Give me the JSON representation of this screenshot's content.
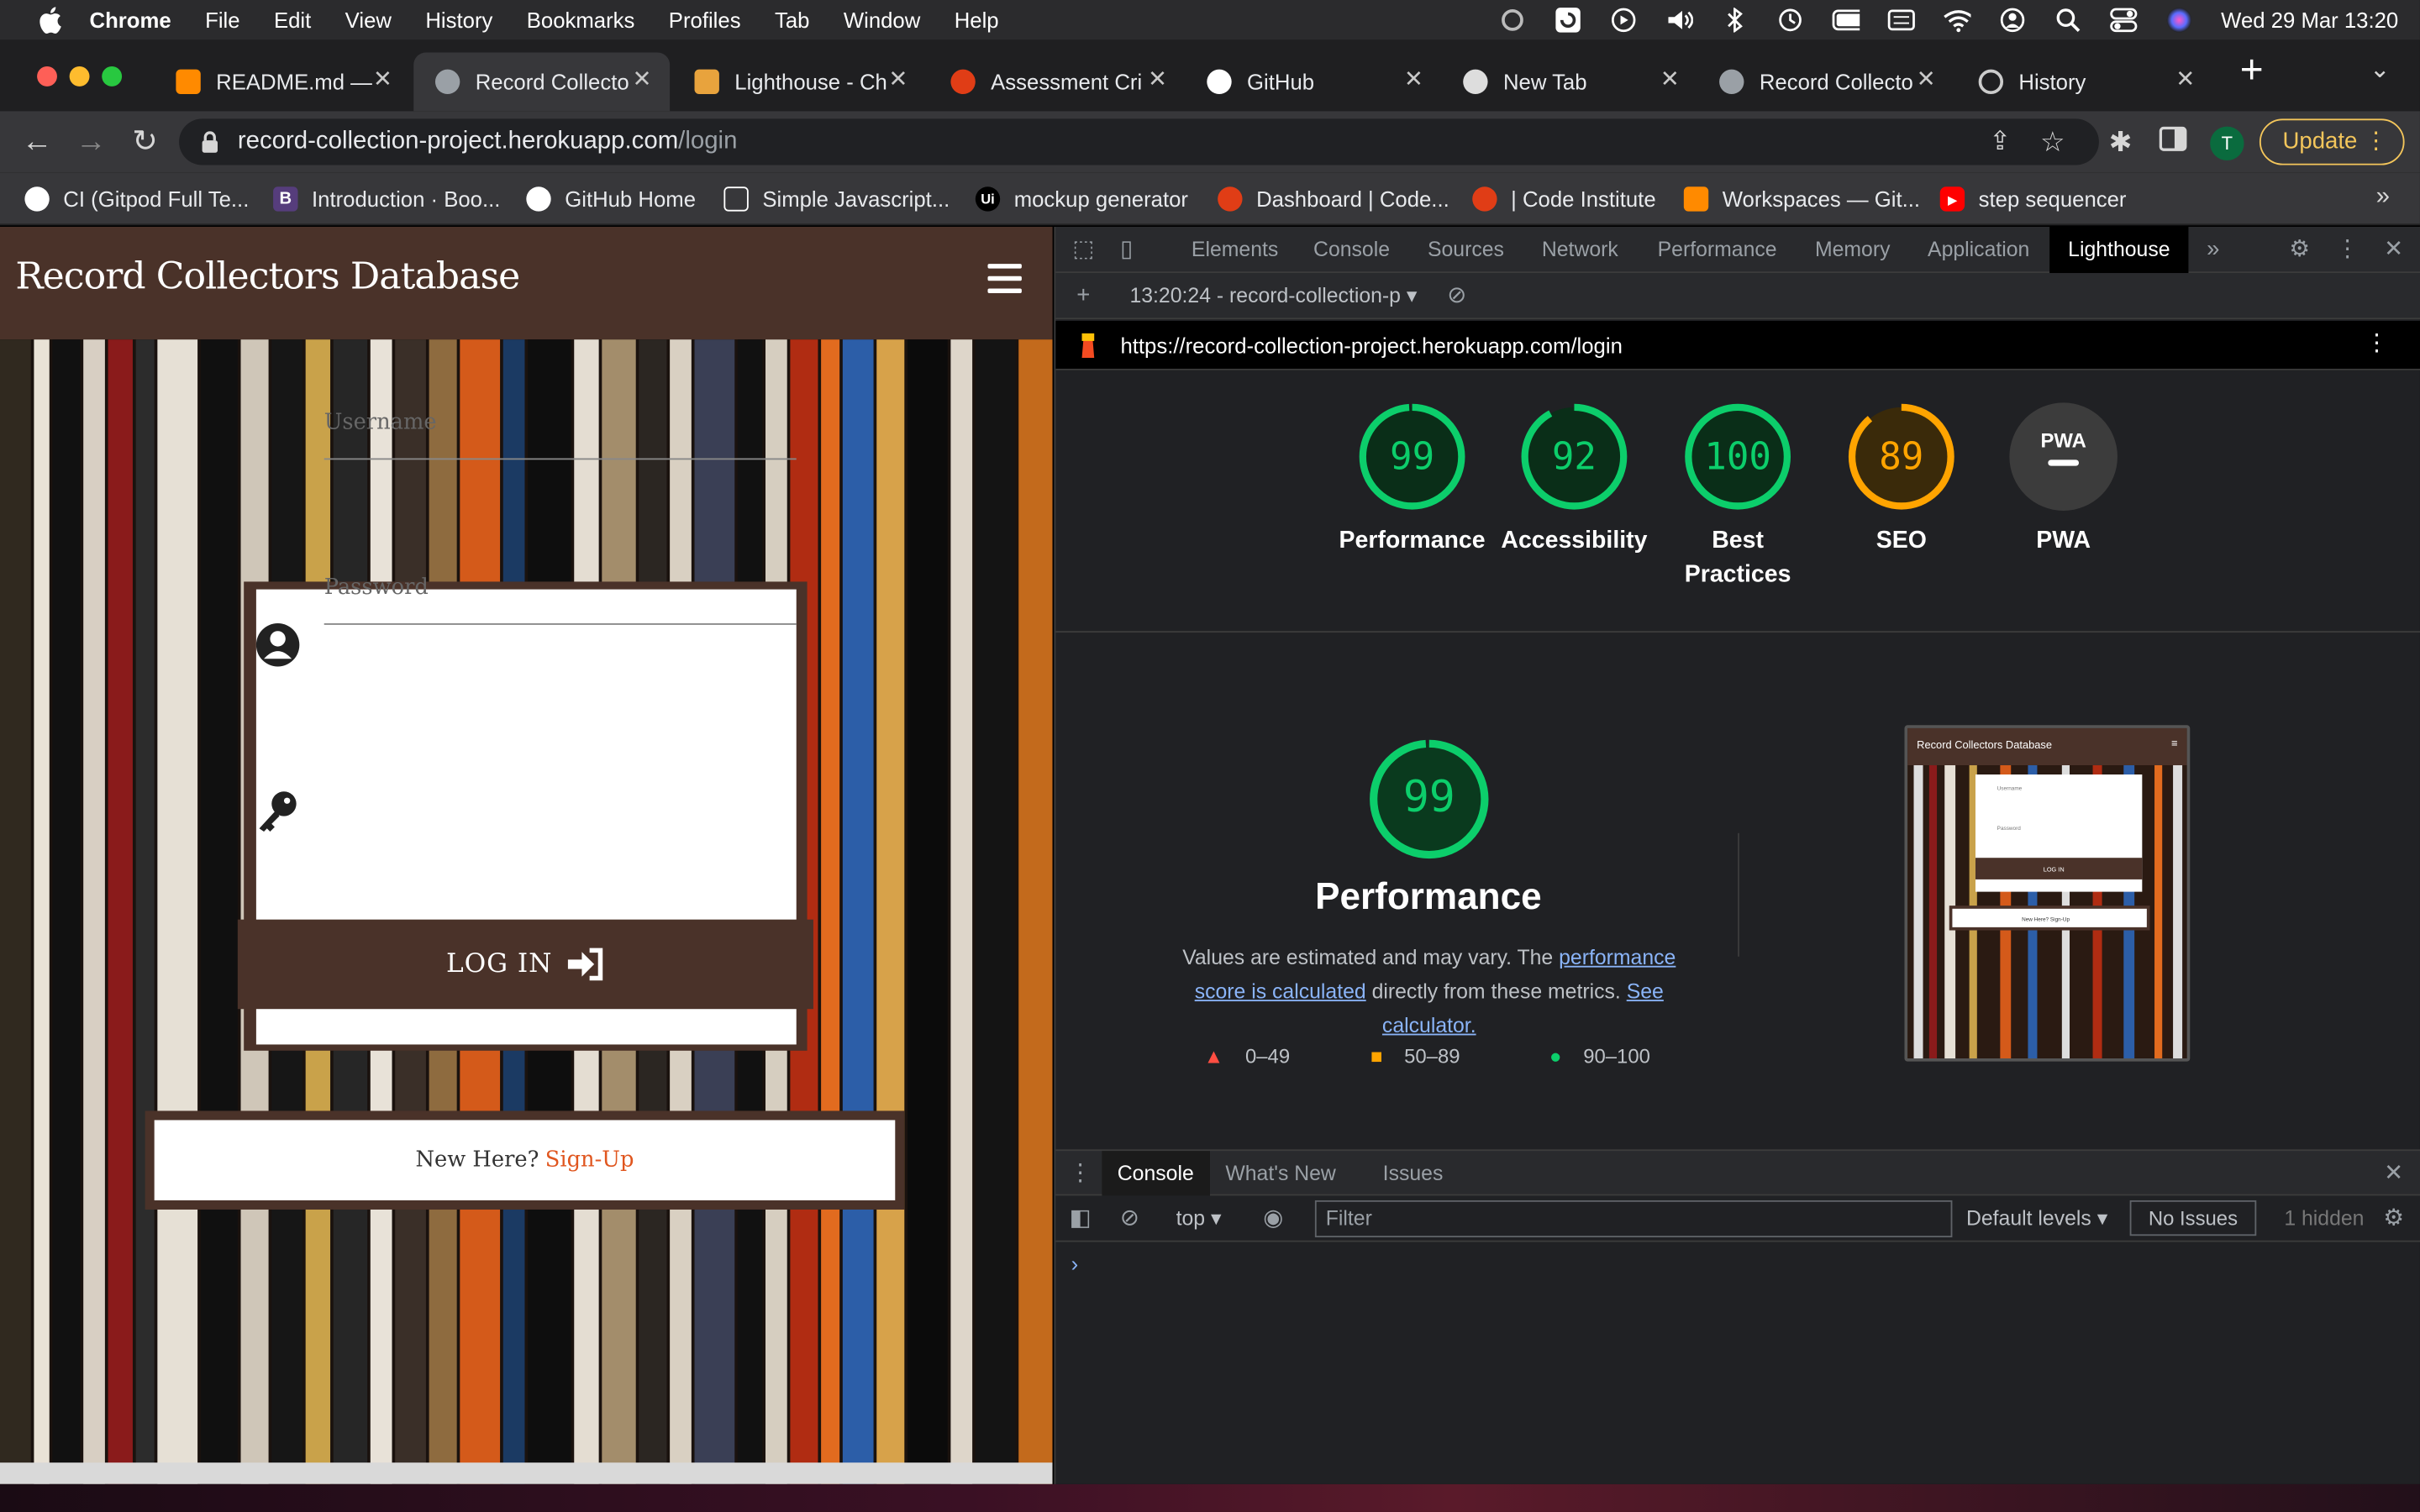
{
  "menubar": {
    "app": "Chrome",
    "items": [
      "File",
      "Edit",
      "View",
      "History",
      "Bookmarks",
      "Profiles",
      "Tab",
      "Window",
      "Help"
    ],
    "clock": "Wed 29 Mar  13:20"
  },
  "tabs": [
    {
      "title": "README.md — ",
      "icon": "gitpod-icon"
    },
    {
      "title": "Record Collecto",
      "icon": "globe-icon",
      "active": true
    },
    {
      "title": "Lighthouse - Ch",
      "icon": "lighthouse-icon"
    },
    {
      "title": "Assessment Cri",
      "icon": "code-institute-icon"
    },
    {
      "title": "GitHub",
      "icon": "github-icon"
    },
    {
      "title": "New Tab",
      "icon": "chrome-icon"
    },
    {
      "title": "Record Collecto",
      "icon": "globe-icon"
    },
    {
      "title": "History",
      "icon": "history-icon"
    }
  ],
  "omnibox": {
    "host": "record-collection-project.herokuapp.com",
    "path": "/login"
  },
  "toolbar": {
    "update_label": "Update",
    "avatar_letter": "T"
  },
  "bookmarks": [
    {
      "label": "CI (Gitpod Full Te...",
      "icon": "github-icon"
    },
    {
      "label": "Introduction · Boo...",
      "icon": "bootstrap-icon"
    },
    {
      "label": "GitHub Home",
      "icon": "github-icon"
    },
    {
      "label": "Simple Javascript...",
      "icon": "codepen-icon"
    },
    {
      "label": "mockup generator",
      "icon": "ui-icon"
    },
    {
      "label": "Dashboard | Code...",
      "icon": "code-institute-icon"
    },
    {
      "label": "| Code Institute",
      "icon": "code-institute-icon"
    },
    {
      "label": "Workspaces — Git...",
      "icon": "gitpod-icon"
    },
    {
      "label": "step sequencer",
      "icon": "youtube-icon"
    }
  ],
  "site": {
    "title": "Record Collectors Database",
    "username_placeholder": "Username",
    "password_placeholder": "Password",
    "login_label": "LOG IN",
    "signup_prompt": "New Here?",
    "signup_link": "Sign-Up",
    "thumb_title": "Record Collectors Database",
    "thumb_username": "Username",
    "thumb_password": "Password",
    "thumb_login": "LOG IN",
    "thumb_signup": "New Here? Sign-Up"
  },
  "devtools": {
    "tabs": [
      "Elements",
      "Console",
      "Sources",
      "Network",
      "Performance",
      "Memory",
      "Application",
      "Lighthouse"
    ],
    "active_tab": "Lighthouse",
    "run_label": "13:20:24 - record-collection-p",
    "report_url": "https://record-collection-project.herokuapp.com/login",
    "scores": [
      {
        "label": "Performance",
        "value": 99,
        "color": "#0cce6b"
      },
      {
        "label": "Accessibility",
        "value": 92,
        "color": "#0cce6b"
      },
      {
        "label": "Best Practices",
        "value": 100,
        "color": "#0cce6b"
      },
      {
        "label": "SEO",
        "value": 89,
        "color": "#ffa400"
      },
      {
        "label": "PWA",
        "value": null,
        "badge": "PWA"
      }
    ],
    "perf": {
      "score": "99",
      "title": "Performance",
      "note_before": "Values are estimated and may vary. The ",
      "note_link1": "performance score is calculated",
      "note_middle": " directly from these metrics. ",
      "note_link2": "See calculator.",
      "legend": [
        {
          "range": "0–49",
          "color": "#ff4e42"
        },
        {
          "range": "50–89",
          "color": "#ffa400"
        },
        {
          "range": "90–100",
          "color": "#0cce6b"
        }
      ]
    },
    "drawer": {
      "tabs": [
        "Console",
        "What's New",
        "Issues"
      ],
      "context": "top",
      "filter_placeholder": "Filter",
      "levels": "Default levels",
      "issues": "No Issues",
      "hidden": "1 hidden"
    }
  }
}
